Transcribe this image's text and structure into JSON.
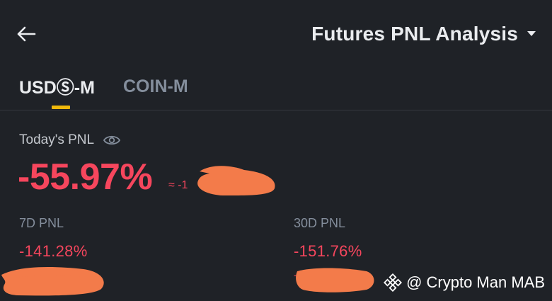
{
  "header": {
    "title": "Futures PNL Analysis"
  },
  "tabs": [
    {
      "label": "USDⓈ-M",
      "active": true
    },
    {
      "label": "COIN-M",
      "active": false
    }
  ],
  "today": {
    "label": "Today's PNL",
    "value": "-55.97%",
    "approx_prefix": "≈ -1"
  },
  "pnl_7d": {
    "label": "7D PNL",
    "value": "-141.28%"
  },
  "pnl_30d": {
    "label": "30D PNL",
    "value": "-151.76%",
    "approx_prefix": "-"
  },
  "watermark": {
    "text": "@ Crypto Man MAB"
  },
  "colors": {
    "background": "#1f2227",
    "accent": "#f0b90b",
    "negative": "#f6465d",
    "redaction": "#f37b4a"
  },
  "icons": {
    "back": "arrow-left-icon",
    "title_dropdown": "caret-down-icon",
    "visibility": "eye-icon",
    "watermark_logo": "binance-logo-icon"
  }
}
